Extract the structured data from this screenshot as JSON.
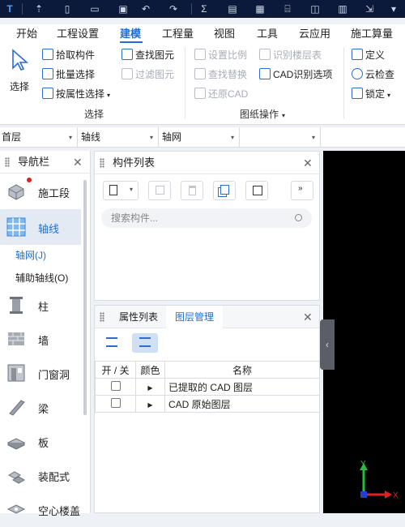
{
  "menu": {
    "items": [
      "开始",
      "工程设置",
      "建模",
      "工程量",
      "视图",
      "工具",
      "云应用",
      "施工算量"
    ],
    "active": "建模"
  },
  "ribbon": {
    "select_label": "选择",
    "pick": "拾取构件",
    "batch": "批量选择",
    "by_attr": "按属性选择",
    "find": "查找图元",
    "filter": "过滤图元",
    "set_ratio": "设置比例",
    "find_replace": "查找替换",
    "restore_cad": "还原CAD",
    "identify_floor": "识别楼层表",
    "cad_options": "CAD识别选项",
    "define": "定义",
    "cloud_check": "云检查",
    "lock": "锁定",
    "group_select": "选择",
    "group_drawing": "图纸操作"
  },
  "floorbar": {
    "floor": "首层",
    "category": "轴线",
    "type": "轴网"
  },
  "nav": {
    "title": "导航栏",
    "items": [
      {
        "label": "施工段"
      },
      {
        "label": "轴线"
      },
      {
        "label": "柱"
      },
      {
        "label": "墙"
      },
      {
        "label": "门窗洞"
      },
      {
        "label": "梁"
      },
      {
        "label": "板"
      },
      {
        "label": "装配式"
      },
      {
        "label": "空心楼盖"
      }
    ],
    "subitems": [
      "轴网(J)",
      "辅助轴线(O)"
    ]
  },
  "component_list": {
    "title": "构件列表",
    "search_placeholder": "搜索构件..."
  },
  "layer_panel": {
    "tabs": [
      "属性列表",
      "图层管理"
    ],
    "active_tab": "图层管理",
    "columns": [
      "开 / 关",
      "颜色",
      "名称"
    ],
    "rows": [
      {
        "name": "已提取的 CAD 图层"
      },
      {
        "name": "CAD 原始图层"
      }
    ]
  },
  "axes": {
    "x": "X",
    "y": "Y"
  },
  "colors": {
    "accent": "#1f6fd6",
    "titlebar": "#0b1a3b",
    "canvas": "#000000"
  }
}
